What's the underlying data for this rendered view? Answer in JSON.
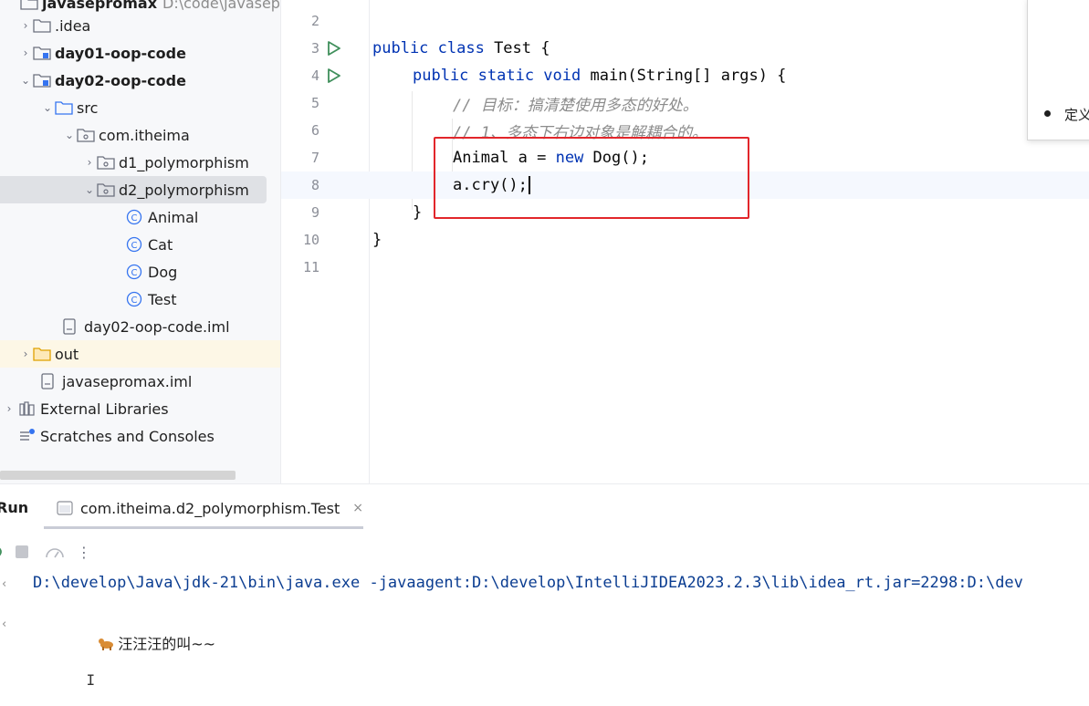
{
  "project_tree": {
    "root": {
      "label": "javasepromax",
      "path": "D:\\code\\javasepro"
    },
    "items": [
      {
        "label": ".idea",
        "type": "folder",
        "expanded": false
      },
      {
        "label": "day01-oop-code",
        "type": "module",
        "expanded": false
      },
      {
        "label": "day02-oop-code",
        "type": "module",
        "expanded": true
      },
      {
        "label": "src",
        "type": "source-folder",
        "expanded": true
      },
      {
        "label": "com.itheima",
        "type": "package",
        "expanded": true
      },
      {
        "label": "d1_polymorphism",
        "type": "package",
        "expanded": false
      },
      {
        "label": "d2_polymorphism",
        "type": "package",
        "expanded": true,
        "selected": true
      },
      {
        "label": "Animal",
        "type": "class"
      },
      {
        "label": "Cat",
        "type": "class"
      },
      {
        "label": "Dog",
        "type": "class"
      },
      {
        "label": "Test",
        "type": "class"
      },
      {
        "label": "day02-oop-code.iml",
        "type": "iml"
      },
      {
        "label": "out",
        "type": "folder-excluded",
        "expanded": false
      },
      {
        "label": "javasepromax.iml",
        "type": "iml"
      },
      {
        "label": "External Libraries",
        "type": "libraries"
      },
      {
        "label": "Scratches and Consoles",
        "type": "scratches"
      }
    ]
  },
  "editor": {
    "lines": [
      {
        "num": "2"
      },
      {
        "num": "3",
        "runnable": true,
        "kw": "public class",
        "text": " Test {"
      },
      {
        "num": "4",
        "runnable": true,
        "kw": "public static void",
        "text": " main(String[] args) {"
      },
      {
        "num": "5",
        "comment": "// 目标：搞清楚使用多态的好处。"
      },
      {
        "num": "6",
        "comment": "// 1、多态下右边对象是解耦合的。"
      },
      {
        "num": "7",
        "pre": "Animal a = ",
        "kw": "new",
        "post": " Dog();"
      },
      {
        "num": "8",
        "text": "a.cry();"
      },
      {
        "num": "9",
        "text": "}"
      },
      {
        "num": "10",
        "text": "}"
      },
      {
        "num": "11"
      }
    ]
  },
  "popup": {
    "bullet_text": "定义"
  },
  "run_panel": {
    "title": "Run",
    "tab_label": "com.itheima.d2_polymorphism.Test",
    "tab_close": "×",
    "console_command": "D:\\develop\\Java\\jdk-21\\bin\\java.exe -javaagent:D:\\develop\\IntelliJIDEA2023.2.3\\lib\\idea_rt.jar=2298:D:\\dev",
    "console_output": "汪汪汪的叫~~",
    "toolbar_more": "⋮"
  },
  "colors": {
    "keyword": "#0033b3",
    "comment": "#8c8c8c",
    "highlight_box": "#e2262b",
    "run_icon": "#3f8f5b"
  }
}
